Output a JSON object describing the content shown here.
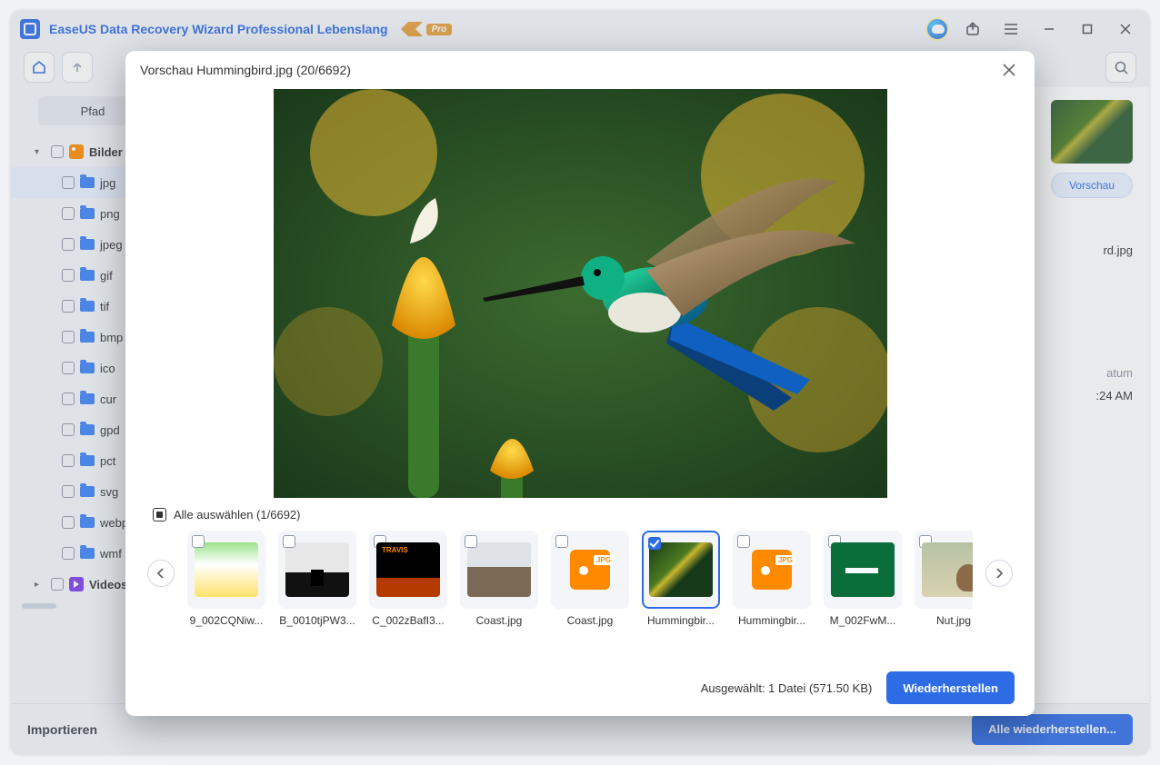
{
  "app": {
    "title": "EaseUS Data Recovery Wizard Professional Lebenslang",
    "pro_badge": "Pro"
  },
  "toolbar": {
    "path_label": "Pfad"
  },
  "sidebar": {
    "categories": [
      {
        "key": "bilder",
        "label": "Bilder",
        "icon": "img",
        "expanded": true
      },
      {
        "key": "videos",
        "label": "Videos",
        "icon": "vid",
        "expanded": false
      }
    ],
    "bilder_types": [
      "jpg",
      "png",
      "jpeg",
      "gif",
      "tif",
      "bmp",
      "ico",
      "cur",
      "gpd",
      "pct",
      "svg",
      "webp",
      "wmf"
    ],
    "selected_type": "jpg"
  },
  "rightpanel": {
    "preview_btn": "Vorschau",
    "filename_suffix": "rd.jpg",
    "date_label": "atum",
    "date_value": ":24 AM"
  },
  "footer": {
    "import_label": "Importieren",
    "recover_all": "Alle wiederherstellen..."
  },
  "modal": {
    "title": "Vorschau Hummingbird.jpg (20/6692)",
    "select_all": "Alle auswählen (1/6692)",
    "selected_text": "Ausgewählt: 1 Datei (571.50 KB)",
    "recover": "Wiederherstellen",
    "thumbs": [
      {
        "name": "9_002CQNiw...",
        "kind": "ph1"
      },
      {
        "name": "B_0010tjPW3...",
        "kind": "ph2"
      },
      {
        "name": "C_002zBafI3...",
        "kind": "ph3"
      },
      {
        "name": "Coast.jpg",
        "kind": "ph4"
      },
      {
        "name": "Coast.jpg",
        "kind": "jpg"
      },
      {
        "name": "Hummingbir...",
        "kind": "ph6",
        "active": true
      },
      {
        "name": "Hummingbir...",
        "kind": "jpg"
      },
      {
        "name": "M_002FwM...",
        "kind": "ph8"
      },
      {
        "name": "Nut.jpg",
        "kind": "ph9"
      }
    ]
  }
}
